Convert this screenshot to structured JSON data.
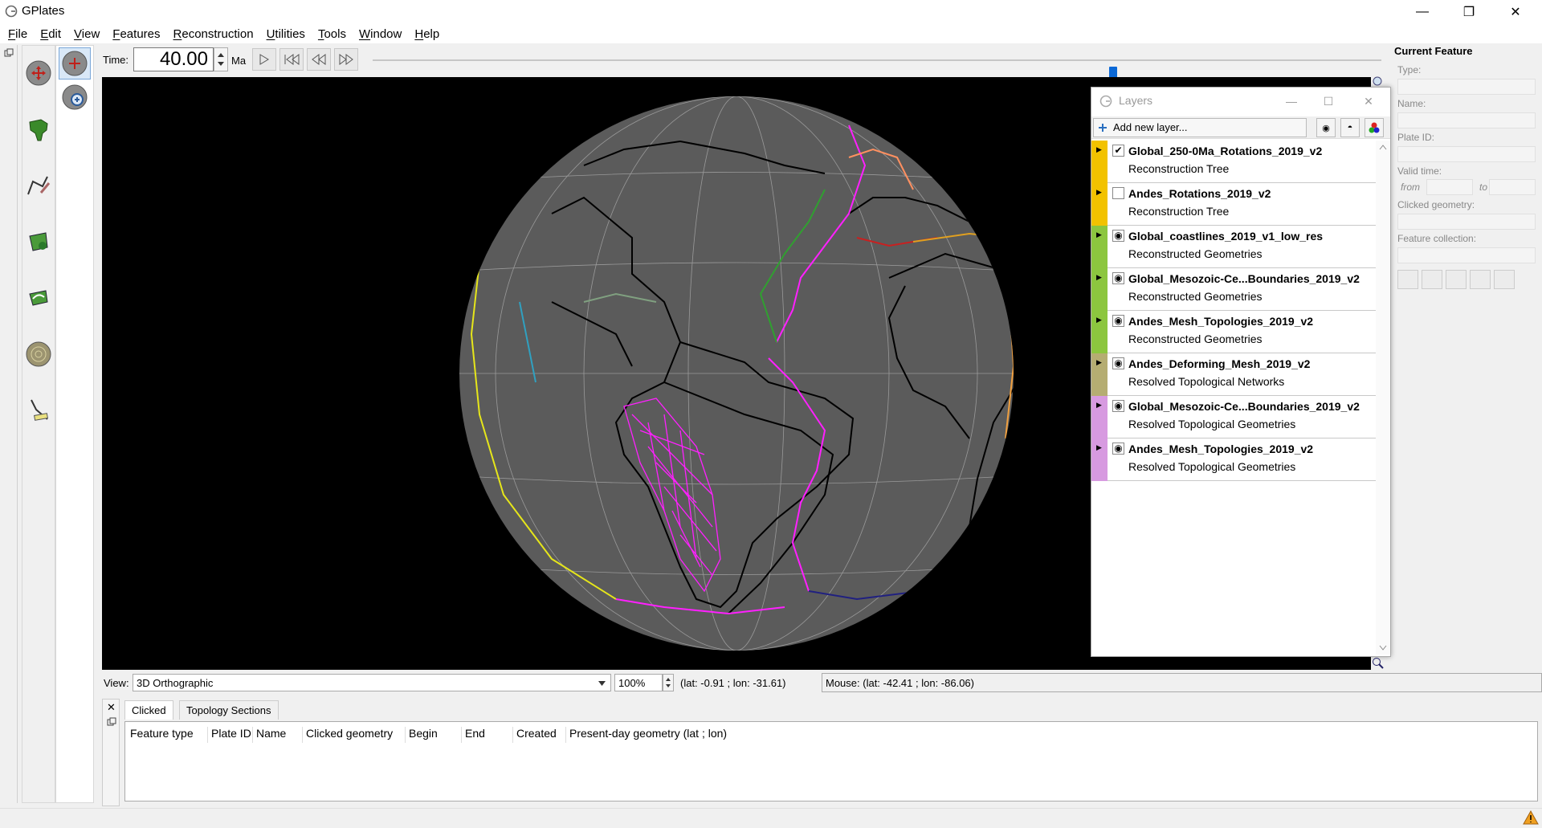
{
  "window": {
    "title": "GPlates",
    "minimize": "—",
    "maximize": "❐",
    "close": "✕"
  },
  "menu": [
    {
      "label": "File",
      "key": "F",
      "rest": "ile"
    },
    {
      "label": "Edit",
      "key": "E",
      "rest": "dit"
    },
    {
      "label": "View",
      "key": "V",
      "rest": "iew"
    },
    {
      "label": "Features",
      "key": "F",
      "rest": "eatures"
    },
    {
      "label": "Reconstruction",
      "key": "R",
      "rest": "econstruction"
    },
    {
      "label": "Utilities",
      "key": "U",
      "rest": "tilities"
    },
    {
      "label": "Tools",
      "key": "T",
      "rest": "ools"
    },
    {
      "label": "Window",
      "key": "W",
      "rest": "indow"
    },
    {
      "label": "Help",
      "key": "H",
      "rest": "elp"
    }
  ],
  "timebar": {
    "label": "Time:",
    "value": "40.00",
    "unit": "Ma",
    "slider_fraction": 0.734
  },
  "layers": {
    "title": "Layers",
    "add_label": "Add new layer...",
    "items": [
      {
        "name": "Global_250-0Ma_Rotations_2019_v2",
        "type": "Reconstruction Tree",
        "color": "#f2c200",
        "visible": "✔"
      },
      {
        "name": "Andes_Rotations_2019_v2",
        "type": "Reconstruction Tree",
        "color": "#f2c200",
        "visible": ""
      },
      {
        "name": "Global_coastlines_2019_v1_low_res",
        "type": "Reconstructed Geometries",
        "color": "#8cc63f",
        "visible": "◉"
      },
      {
        "name": "Global_Mesozoic-Ce...Boundaries_2019_v2",
        "type": "Reconstructed Geometries",
        "color": "#8cc63f",
        "visible": "◉"
      },
      {
        "name": "Andes_Mesh_Topologies_2019_v2",
        "type": "Reconstructed Geometries",
        "color": "#8cc63f",
        "visible": "◉"
      },
      {
        "name": "Andes_Deforming_Mesh_2019_v2",
        "type": "Resolved Topological Networks",
        "color": "#b5ad72",
        "visible": "◉"
      },
      {
        "name": "Global_Mesozoic-Ce...Boundaries_2019_v2",
        "type": "Resolved Topological Geometries",
        "color": "#d79ae0",
        "visible": "◉"
      },
      {
        "name": "Andes_Mesh_Topologies_2019_v2",
        "type": "Resolved Topological Geometries",
        "color": "#d79ae0",
        "visible": "◉"
      }
    ]
  },
  "feature_panel": {
    "title": "Current Feature",
    "type_label": "Type:",
    "name_label": "Name:",
    "plate_label": "Plate ID:",
    "valid_label": "Valid time:",
    "from_label": "from",
    "to_label": "to",
    "clicked_label": "Clicked geometry:",
    "collection_label": "Feature collection:"
  },
  "viewbar": {
    "label": "View:",
    "projection": "3D Orthographic",
    "zoom": "100%",
    "camera": "(lat: -0.91 ; lon: -31.61)",
    "mouse": "Mouse: (lat: -42.41 ; lon: -86.06)"
  },
  "bottom": {
    "tabs": [
      "Clicked",
      "Topology Sections"
    ],
    "columns": [
      "Feature type",
      "Plate ID",
      "Name",
      "Clicked geometry",
      "Begin",
      "End",
      "Created",
      "Present-day geometry (lat ; lon)"
    ]
  }
}
